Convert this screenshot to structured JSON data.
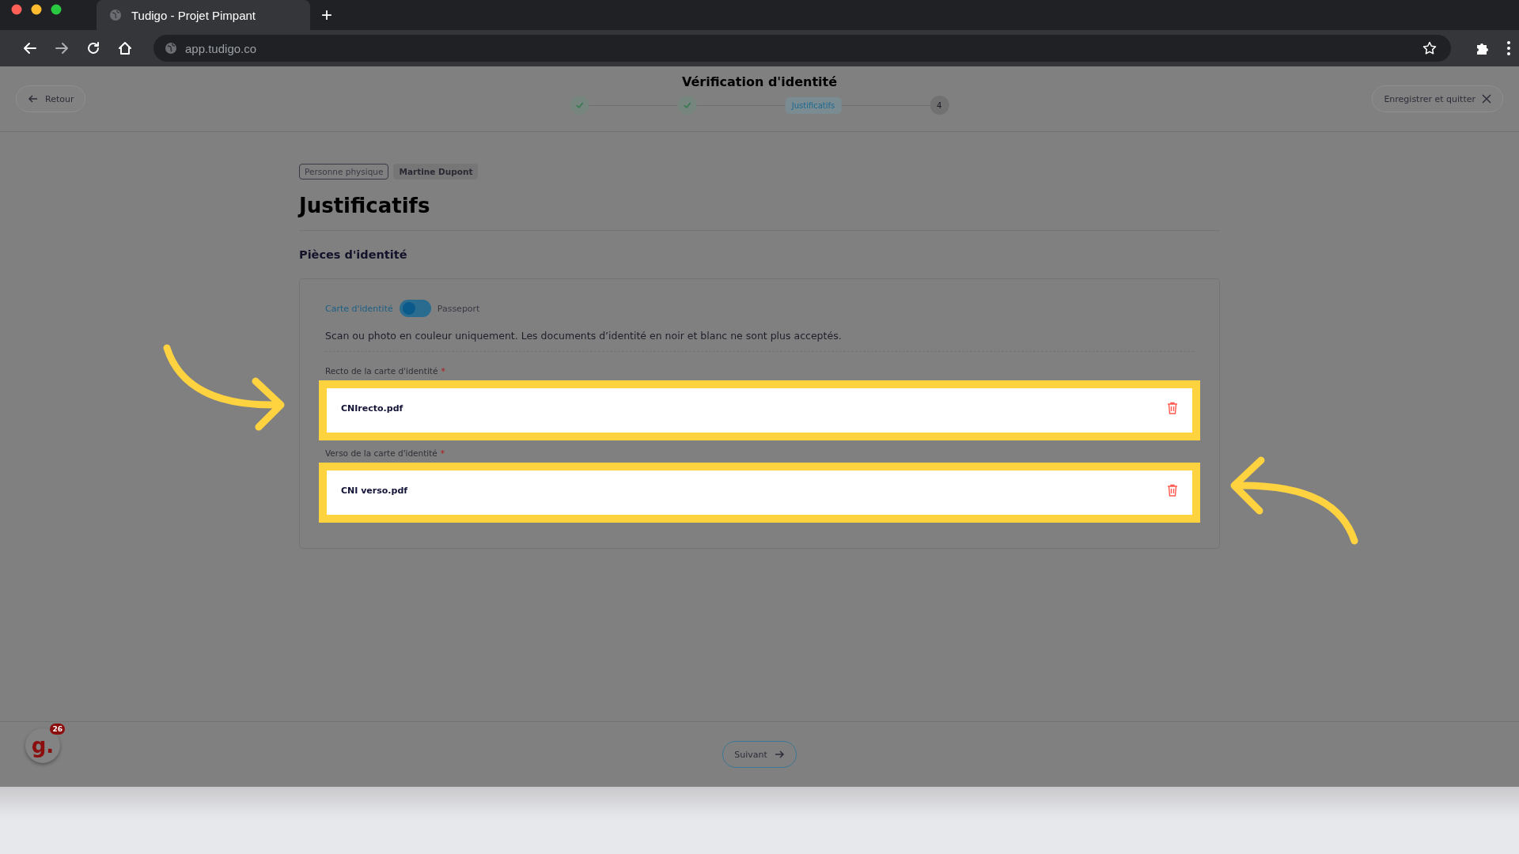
{
  "browser": {
    "tab_title": "Tudigo - Projet Pimpant",
    "new_tab": "+",
    "url": "app.tudigo.co"
  },
  "header": {
    "back": "Retour",
    "title": "Vérification d'identité",
    "save_quit": "Enregistrer et quitter",
    "steps": [
      {
        "kind": "check"
      },
      {
        "kind": "check"
      },
      {
        "kind": "pill",
        "label": "Justificatifs"
      },
      {
        "kind": "number",
        "label": "4"
      }
    ]
  },
  "tags": [
    {
      "label": "Personne physique",
      "kind": "outline"
    },
    {
      "label": "Martine Dupont",
      "kind": "filled"
    }
  ],
  "page_title": "Justificatifs",
  "section_title": "Pièces d'identité",
  "doc_type": {
    "options": [
      {
        "label": "Carte d'identité",
        "selected": true
      },
      {
        "label": "Passeport",
        "selected": false
      }
    ]
  },
  "note": "Scan ou photo en couleur uniquement. Les documents d’identité en noir et blanc ne sont plus acceptés.",
  "uploads": [
    {
      "label": "Recto de la carte d'identité",
      "required_mark": "*",
      "file": "CNIrecto.pdf",
      "highlighted": true
    },
    {
      "label": "Verso de la carte d'identité",
      "required_mark": "*",
      "file": "CNI verso.pdf",
      "highlighted": true
    }
  ],
  "footer": {
    "next": "Suivant",
    "widget_logo": "g.",
    "widget_badge": "26"
  }
}
